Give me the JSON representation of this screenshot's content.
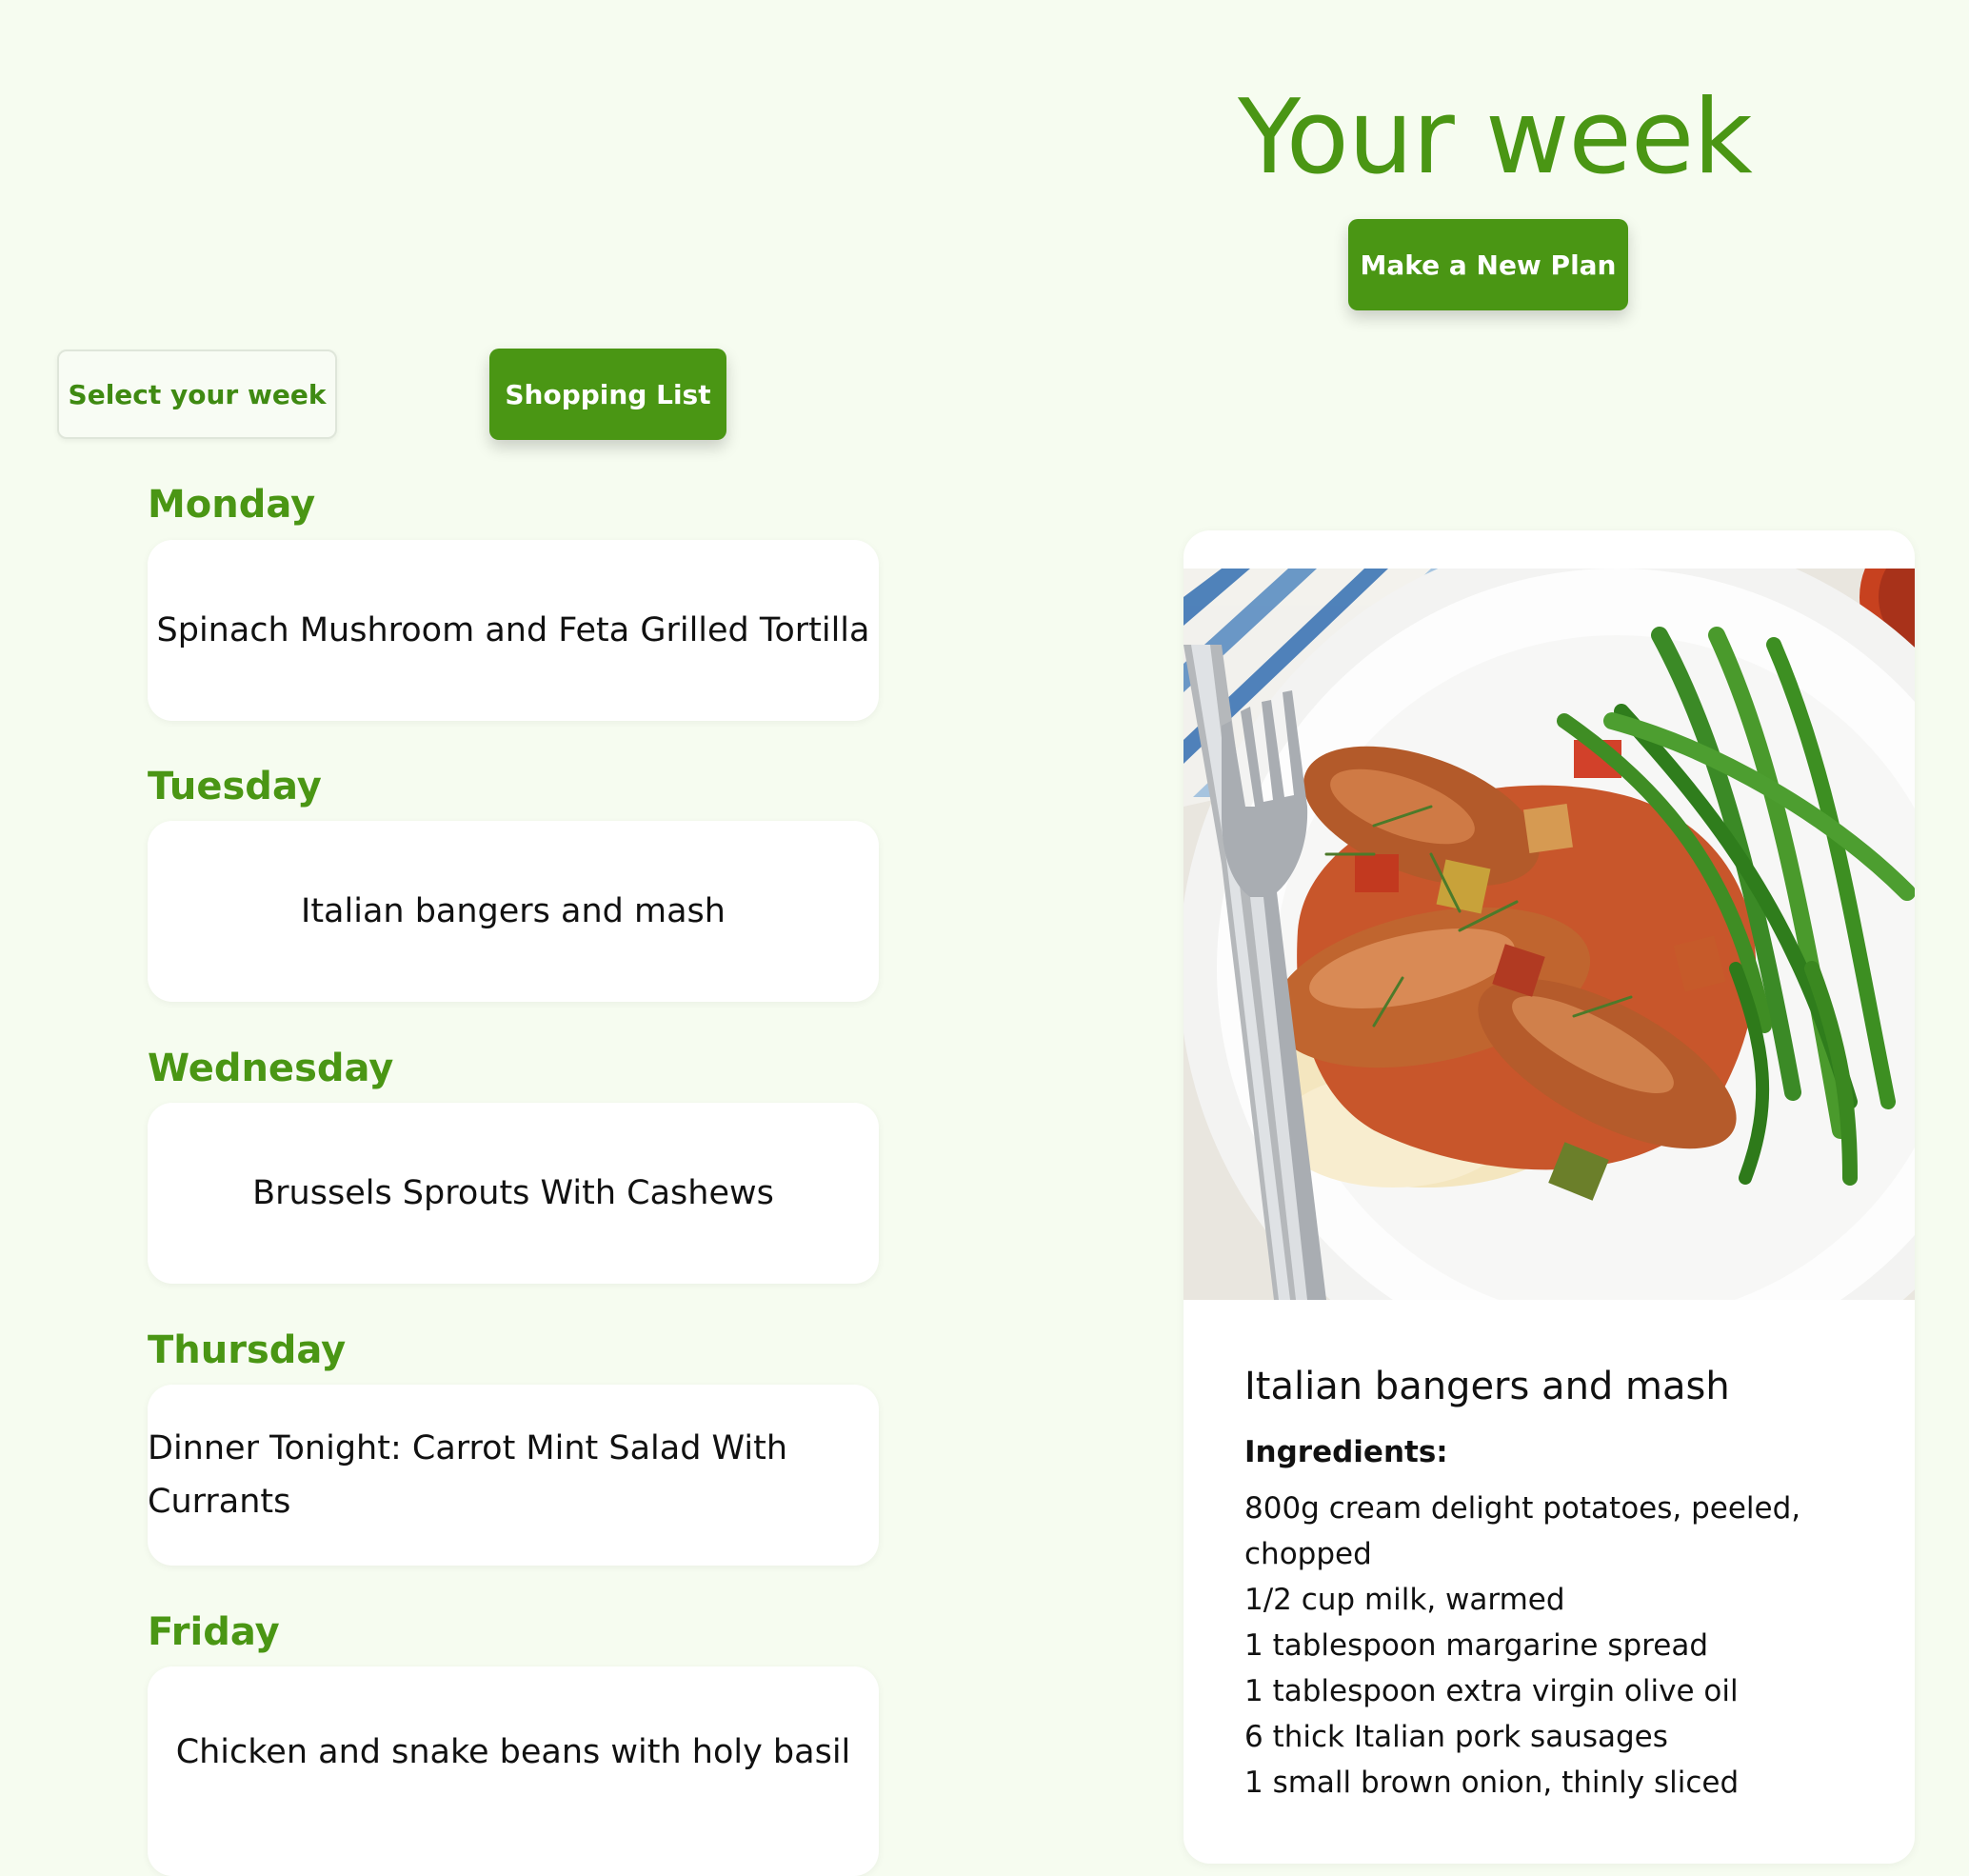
{
  "header": {
    "title": "Your week",
    "new_plan_label": "Make a New Plan"
  },
  "toolbar": {
    "select_week_label": "Select your week",
    "shopping_list_label": "Shopping List"
  },
  "days": [
    {
      "day": "Monday",
      "meal": "Spinach Mushroom and Feta Grilled Tortilla"
    },
    {
      "day": "Tuesday",
      "meal": "Italian bangers and mash"
    },
    {
      "day": "Wednesday",
      "meal": "Brussels Sprouts With Cashews"
    },
    {
      "day": "Thursday",
      "meal": "Dinner Tonight: Carrot Mint Salad With Currants"
    },
    {
      "day": "Friday",
      "meal": "Chicken and snake beans with holy basil"
    }
  ],
  "recipe": {
    "title": "Italian bangers and mash",
    "ingredients_heading": "Ingredients:",
    "ingredients": [
      "800g cream delight potatoes, peeled, chopped",
      "1/2 cup milk, warmed",
      "1 tablespoon margarine spread",
      "1 tablespoon extra virgin olive oil",
      "6 thick Italian pork sausages",
      "1 small brown onion, thinly sliced"
    ]
  },
  "colors": {
    "accent": "#4a9614",
    "background": "#f6fcf0",
    "card": "#ffffff"
  }
}
